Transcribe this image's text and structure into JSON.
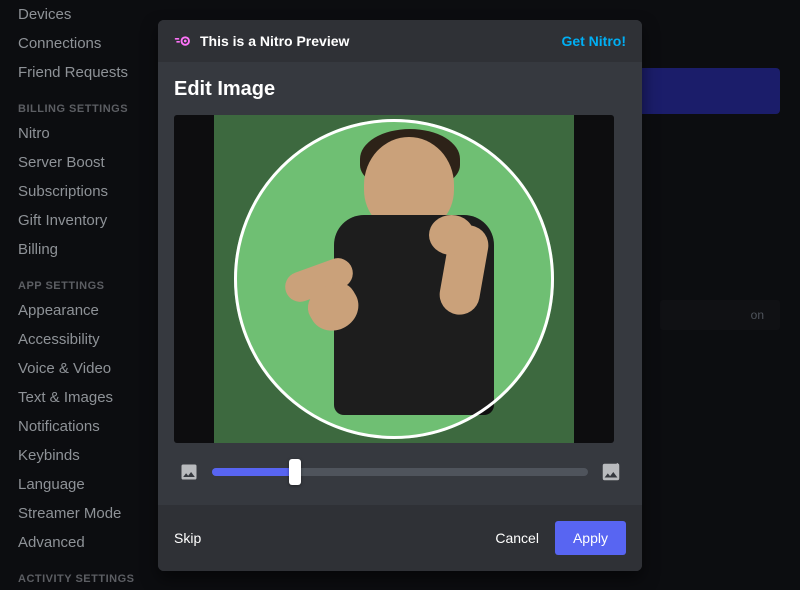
{
  "sidebar": {
    "items_top": [
      {
        "label": "Devices"
      },
      {
        "label": "Connections"
      },
      {
        "label": "Friend Requests"
      }
    ],
    "heading_billing": "Billing Settings",
    "items_billing": [
      {
        "label": "Nitro",
        "badge": true
      },
      {
        "label": "Server Boost"
      },
      {
        "label": "Subscriptions"
      },
      {
        "label": "Gift Inventory"
      },
      {
        "label": "Billing"
      }
    ],
    "heading_app": "App Settings",
    "items_app": [
      {
        "label": "Appearance"
      },
      {
        "label": "Accessibility"
      },
      {
        "label": "Voice & Video"
      },
      {
        "label": "Text & Images"
      },
      {
        "label": "Notifications"
      },
      {
        "label": "Keybinds"
      },
      {
        "label": "Language"
      },
      {
        "label": "Streamer Mode"
      },
      {
        "label": "Advanced"
      }
    ],
    "heading_activity": "Activity Settings"
  },
  "ghost": {
    "btn_suffix": "on"
  },
  "modal": {
    "header": {
      "preview_label": "This is a Nitro Preview",
      "get_nitro": "Get Nitro!"
    },
    "title": "Edit Image",
    "slider": {
      "value_pct": 22
    },
    "footer": {
      "skip": "Skip",
      "cancel": "Cancel",
      "apply": "Apply"
    }
  },
  "colors": {
    "accent": "#5865f2",
    "link": "#00aff4",
    "nitro": "#ff73fa",
    "bg_modal": "#36393f",
    "bg_footer": "#2f3136"
  }
}
